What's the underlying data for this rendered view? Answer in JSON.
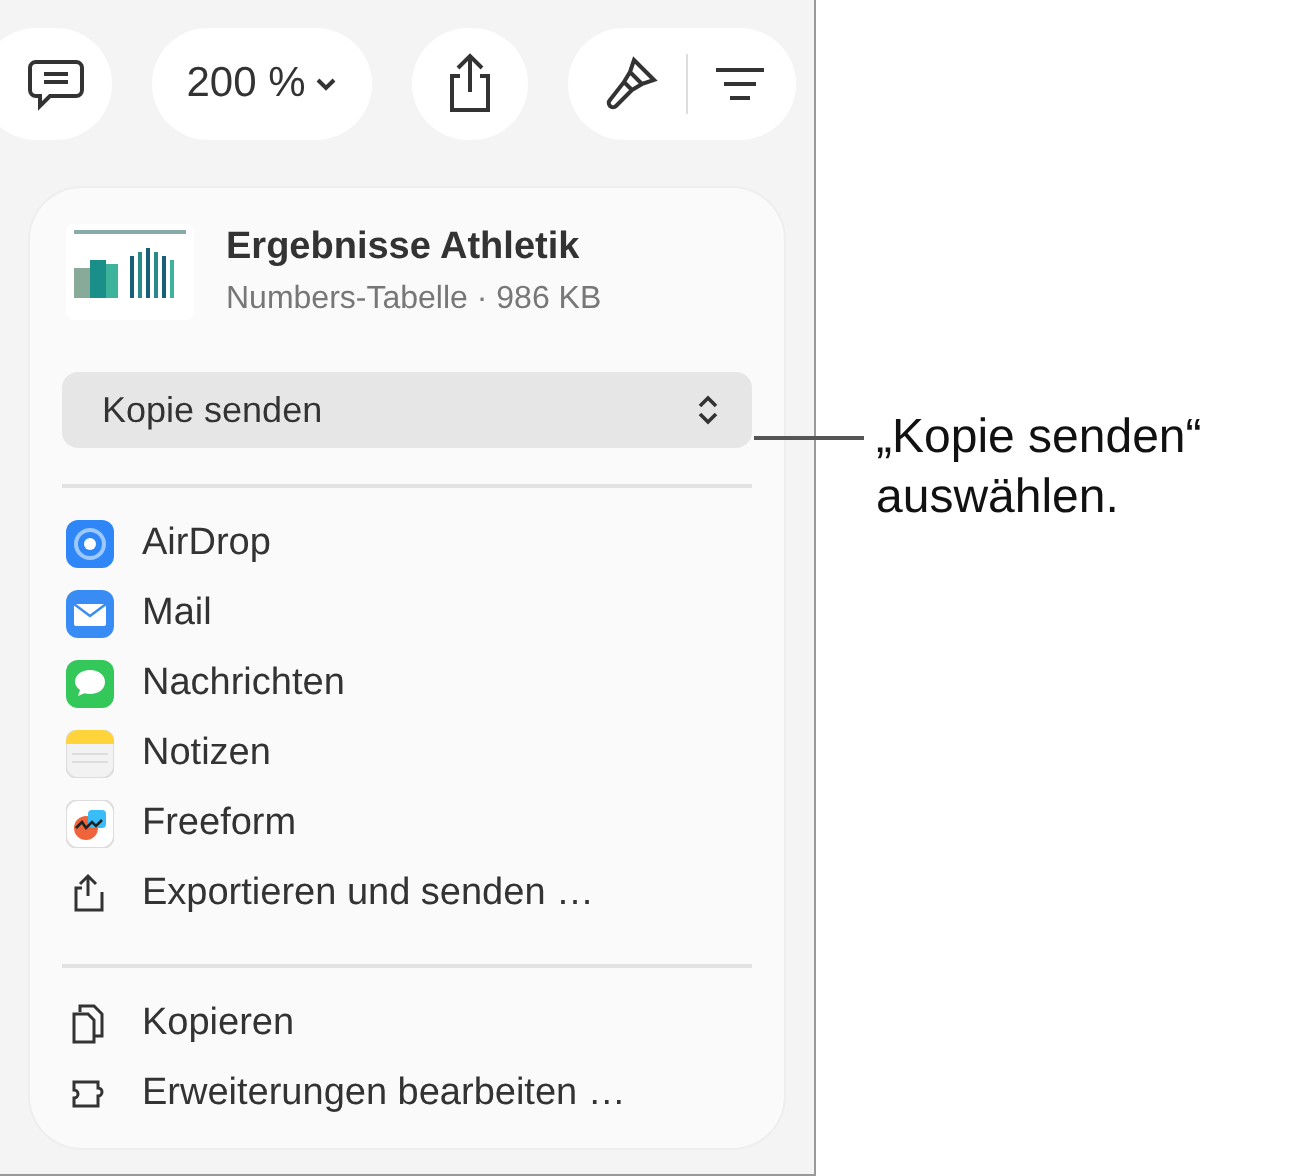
{
  "toolbar": {
    "zoom": "200 %"
  },
  "file": {
    "name": "Ergebnisse Athletik",
    "info": "Numbers-Tabelle · 986 KB"
  },
  "send_menu": {
    "value": "Kopie senden"
  },
  "share_items": [
    {
      "kind": "airdrop",
      "label": "AirDrop"
    },
    {
      "kind": "mail",
      "label": "Mail"
    },
    {
      "kind": "messages",
      "label": "Nachrichten"
    },
    {
      "kind": "notes",
      "label": "Notizen"
    },
    {
      "kind": "freeform",
      "label": "Freeform"
    },
    {
      "kind": "export",
      "label": "Exportieren und senden …"
    }
  ],
  "actions": [
    {
      "kind": "copy",
      "label": "Kopieren"
    },
    {
      "kind": "extensions",
      "label": "Erweiterungen bearbeiten …"
    }
  ],
  "callout": {
    "text": "„Kopie senden“ auswählen."
  }
}
